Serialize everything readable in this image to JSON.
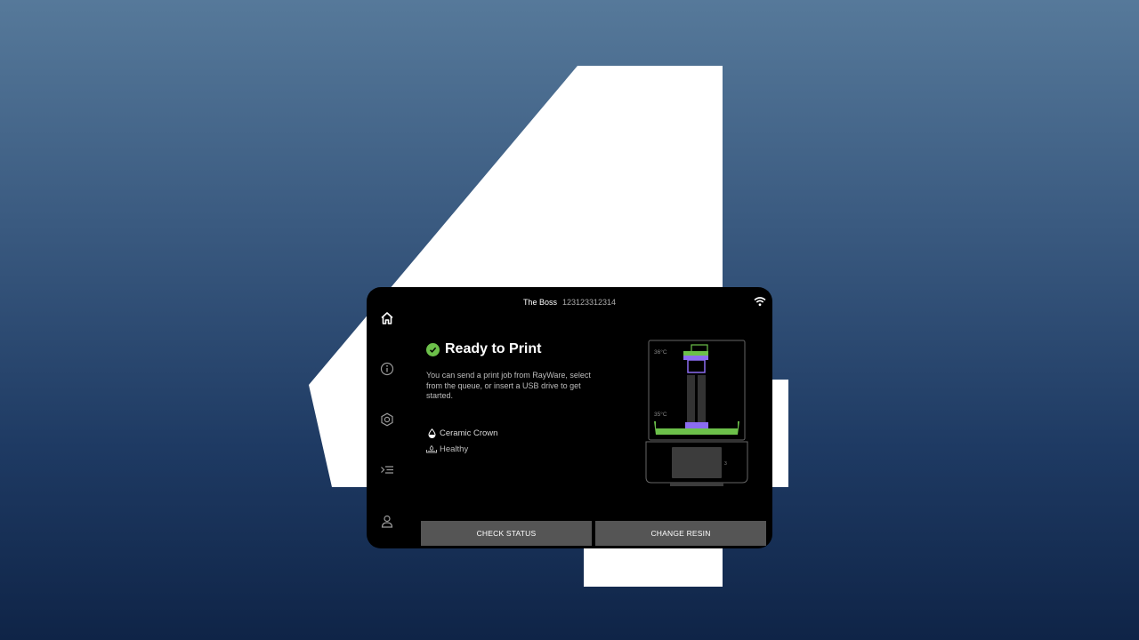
{
  "header": {
    "device_name": "The Boss",
    "serial": "123123312314"
  },
  "nav": {
    "items": [
      {
        "name": "home",
        "icon": "home-icon"
      },
      {
        "name": "info",
        "icon": "info-icon"
      },
      {
        "name": "settings",
        "icon": "hex-nut-icon"
      },
      {
        "name": "queue",
        "icon": "queue-list-icon"
      },
      {
        "name": "account",
        "icon": "user-icon"
      }
    ]
  },
  "status": {
    "title": "Ready to Print",
    "description": "You can send a print job from RayWare, select from the queue, or insert a USB drive to get started.",
    "resin_name": "Ceramic Crown",
    "tank_status": "Healthy",
    "color_ok": "#6cc04a"
  },
  "printer_diagram": {
    "top_temp": "36°C",
    "bottom_temp": "35°C",
    "side_label": "3",
    "resin_color": "#6cc04a",
    "platform_color": "#8b6cf0"
  },
  "actions": {
    "check_status": "CHECK STATUS",
    "change_resin": "CHANGE RESIN"
  }
}
